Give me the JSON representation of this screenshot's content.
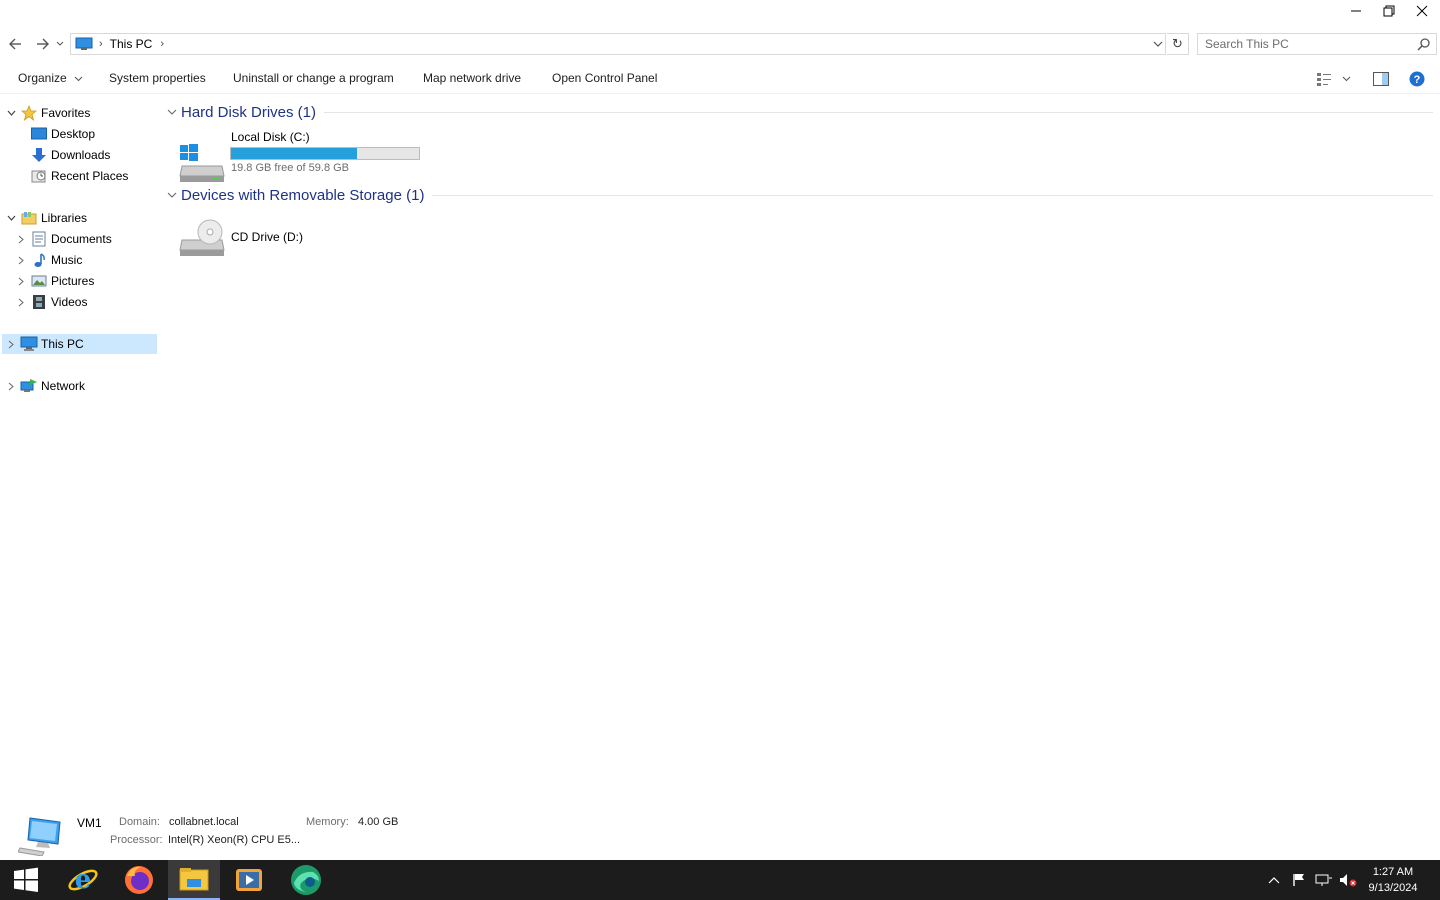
{
  "titlebar": {
    "minimize": "—",
    "maximize": "❐",
    "close": "✕"
  },
  "address": {
    "path_label": "This PC",
    "search_placeholder": "Search This PC"
  },
  "commands": {
    "organize": "Organize",
    "system_properties": "System properties",
    "uninstall": "Uninstall or change a program",
    "map_drive": "Map network drive",
    "control_panel": "Open Control Panel"
  },
  "nav": {
    "favorites": "Favorites",
    "desktop": "Desktop",
    "downloads": "Downloads",
    "recent": "Recent Places",
    "libraries": "Libraries",
    "documents": "Documents",
    "music": "Music",
    "pictures": "Pictures",
    "videos": "Videos",
    "this_pc": "This PC",
    "network": "Network"
  },
  "groups": {
    "hdd": {
      "title": "Hard Disk Drives (1)",
      "drives": [
        {
          "name": "Local Disk (C:)",
          "free_text": "19.8 GB free of 59.8 GB",
          "used_fraction": 0.669
        }
      ]
    },
    "removable": {
      "title": "Devices with Removable Storage (1)",
      "drives": [
        {
          "name": "CD Drive (D:)"
        }
      ]
    }
  },
  "details": {
    "name": "VM1",
    "domain_label": "Domain:",
    "domain": "collabnet.local",
    "memory_label": "Memory:",
    "memory": "4.00 GB",
    "processor_label": "Processor:",
    "processor": "Intel(R) Xeon(R) CPU E5..."
  },
  "taskbar": {
    "apps": [
      "start-icon",
      "internet-explorer-icon",
      "firefox-icon",
      "file-explorer-icon",
      "media-player-icon",
      "browser-globe-icon"
    ],
    "time": "1:27 AM",
    "date": "9/13/2024"
  },
  "colors": {
    "accent": "#26a0da",
    "selection": "#cce8ff",
    "group_title": "#1e3287",
    "taskbar": "#1c1c1c"
  }
}
